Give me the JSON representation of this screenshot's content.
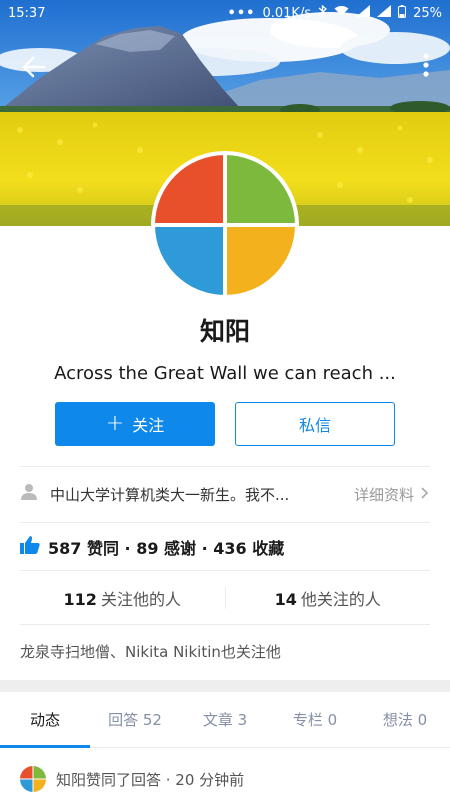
{
  "status_bar": {
    "time": "15:37",
    "dots": "•••",
    "speed": "0.01K/s",
    "battery": "25%"
  },
  "header": {
    "back_icon": "arrow-left-icon",
    "more_icon": "more-vertical-icon"
  },
  "profile": {
    "name": "知阳",
    "headline": "Across the Great Wall we can reach ...",
    "avatar_colors": [
      "#e8502b",
      "#7db93c",
      "#2f9ad8",
      "#f3b21d"
    ]
  },
  "actions": {
    "follow_plus": "+",
    "follow_label": "关注",
    "message_label": "私信"
  },
  "bio": {
    "text": "中山大学计算机类大一新生。我不...",
    "detail_label": "详细资料"
  },
  "stats": {
    "text": "587 赞同 · 89 感谢 · 436 收藏"
  },
  "follow_counts": {
    "followers_count": "112",
    "followers_label": "关注他的人",
    "following_count": "14",
    "following_label": "他关注的人"
  },
  "mutual": {
    "text": "龙泉寺扫地僧、Nikita Nikitin也关注他"
  },
  "tabs": [
    {
      "label": "动态"
    },
    {
      "label": "回答 52"
    },
    {
      "label": "文章 3"
    },
    {
      "label": "专栏 0"
    },
    {
      "label": "想法 0"
    }
  ],
  "feed": {
    "first_item": "知阳赞同了回答 · 20 分钟前"
  },
  "colors": {
    "accent": "#0f88eb",
    "cover_field": "#f1d900"
  }
}
